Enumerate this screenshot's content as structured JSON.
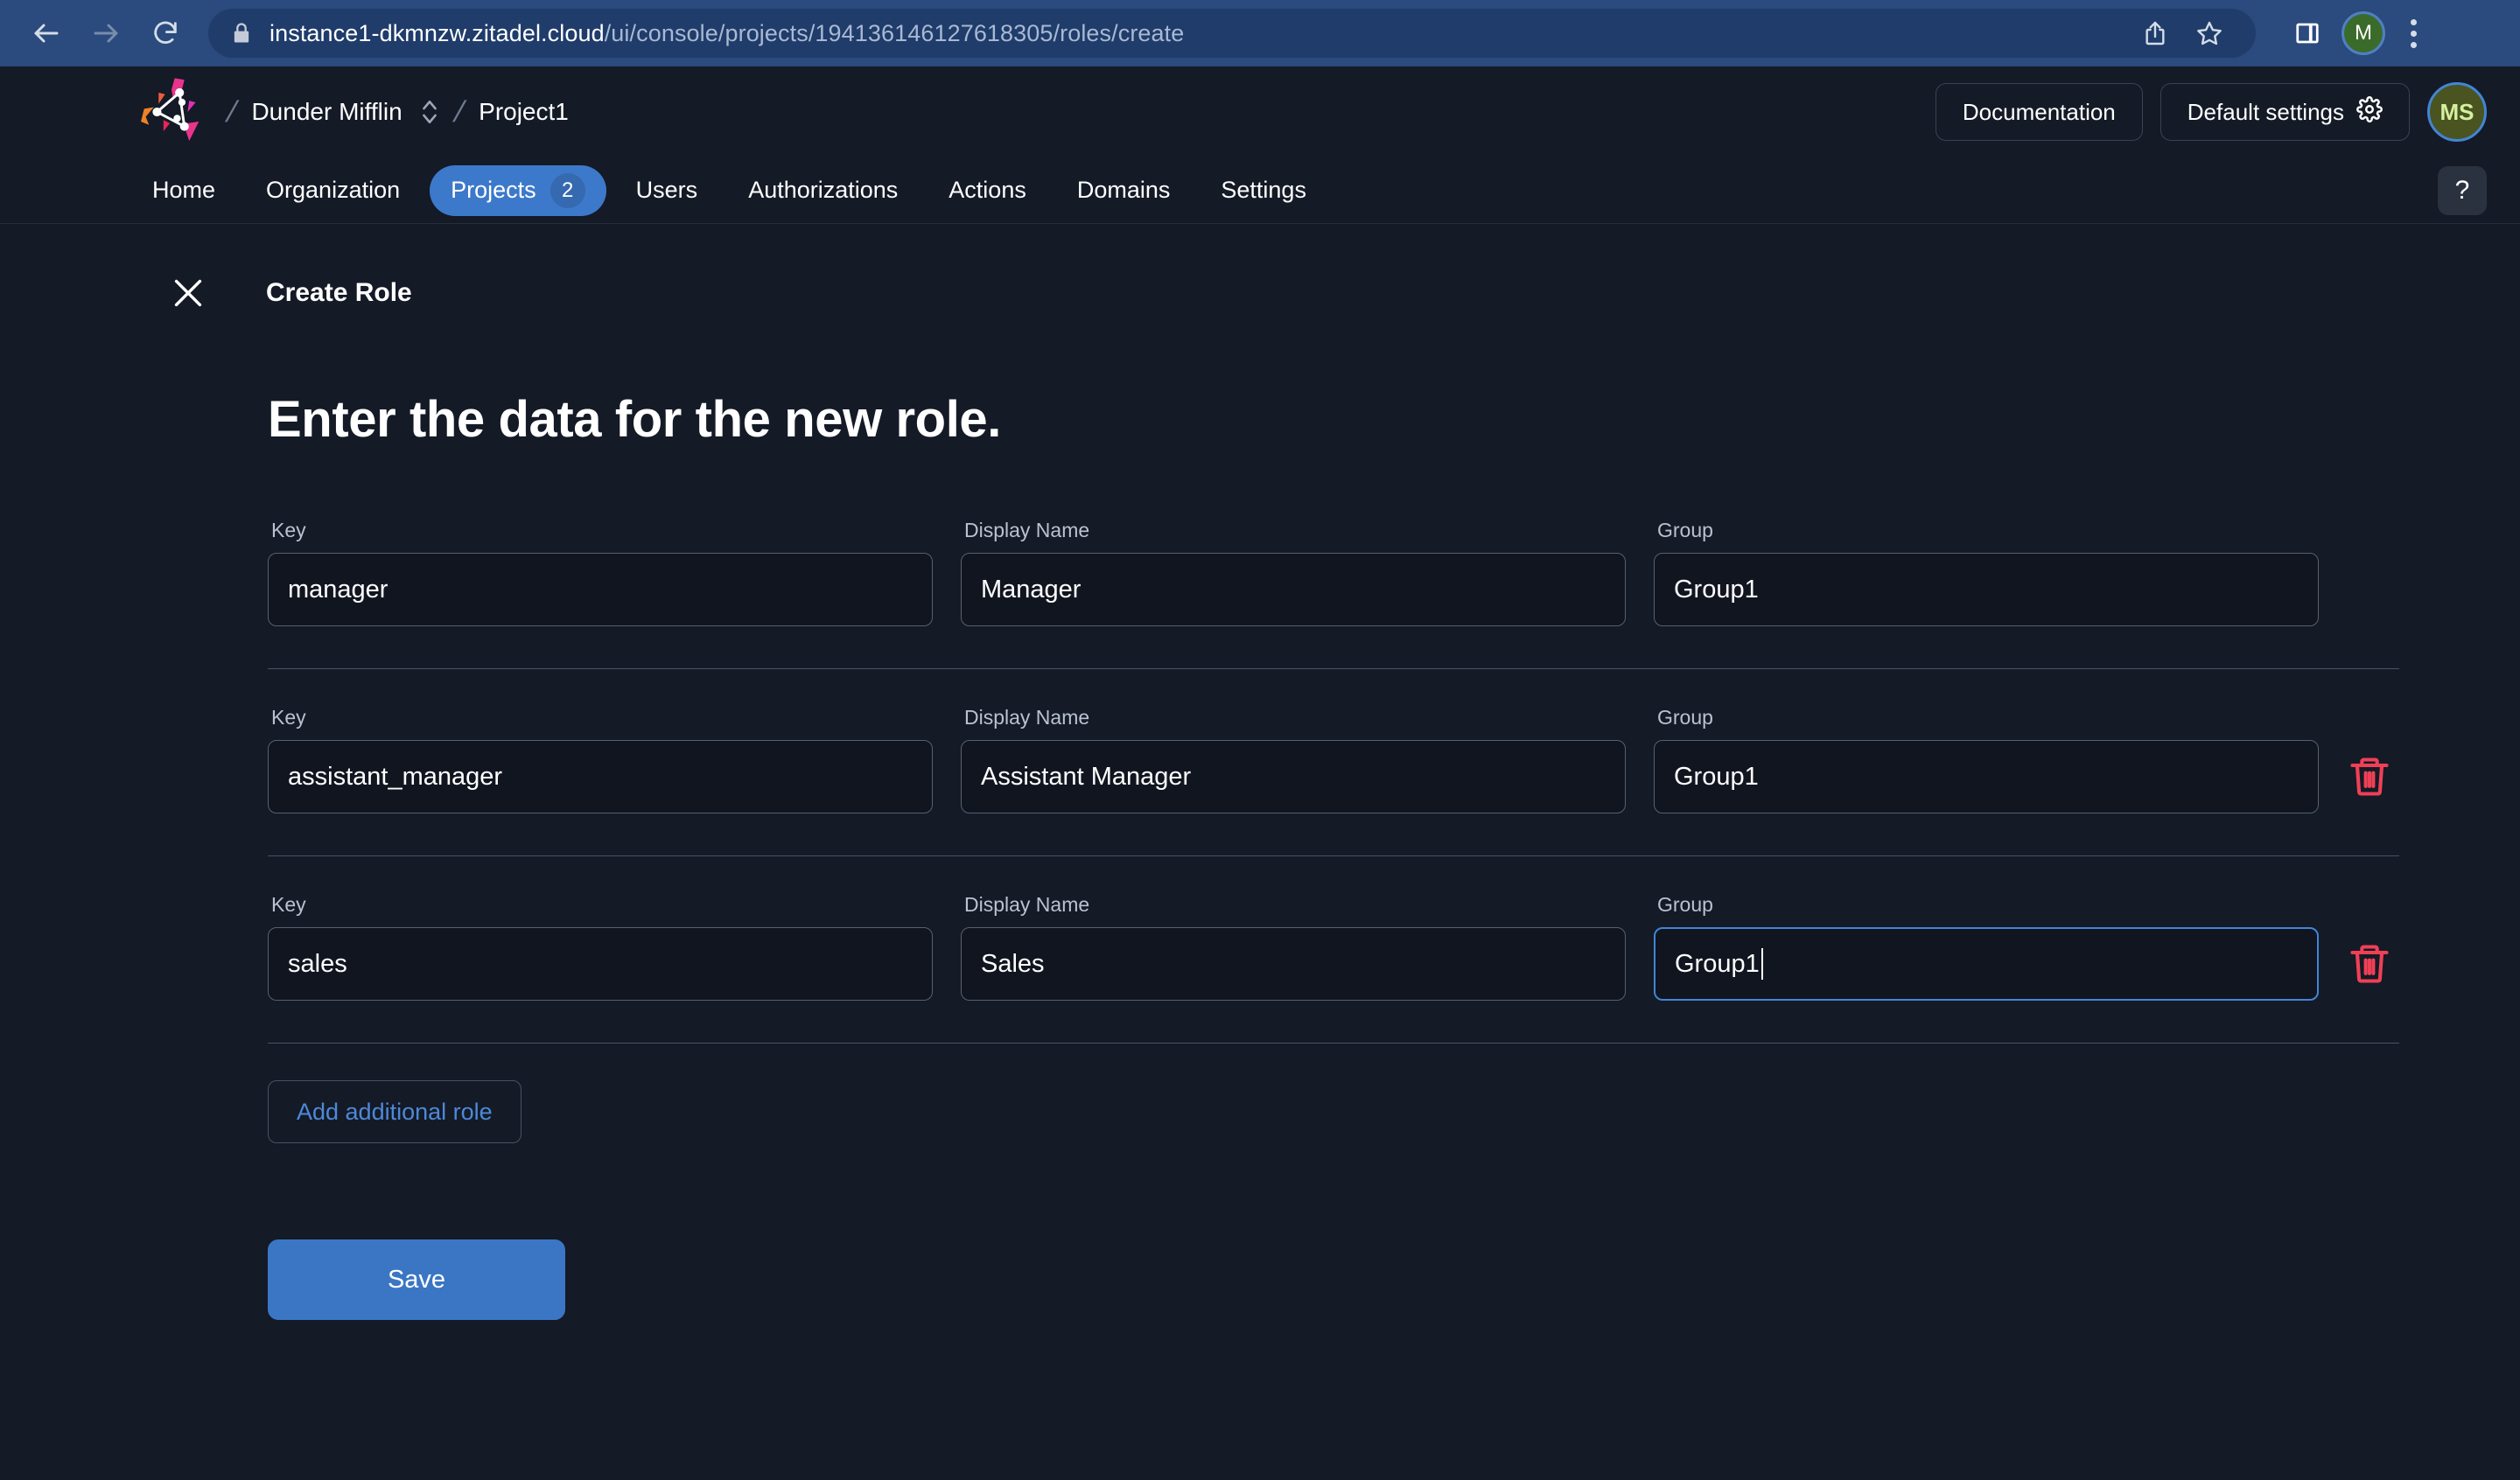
{
  "browser": {
    "back_icon": "back-arrow-icon",
    "forward_icon": "forward-arrow-icon",
    "reload_icon": "reload-icon",
    "lock_icon": "lock-icon",
    "url_domain": "instance1-dkmnzw.zitadel.cloud",
    "url_path": "/ui/console/projects/194136146127618305/roles/create",
    "share_icon": "share-icon",
    "bookmark_icon": "star-icon",
    "sidepanel_icon": "side-panel-icon",
    "profile_initial": "M",
    "menu_icon": "kebab-menu-icon"
  },
  "header": {
    "logo": "zitadel-logo-icon",
    "separator": "/",
    "org_name": "Dunder Mifflin",
    "org_switch_icon": "chevron-up-down-icon",
    "project_name": "Project1",
    "documentation_label": "Documentation",
    "default_settings_label": "Default settings",
    "gear_icon": "gear-icon",
    "user_initials": "MS"
  },
  "nav": {
    "tabs": [
      {
        "label": "Home",
        "active": false,
        "badge": null
      },
      {
        "label": "Organization",
        "active": false,
        "badge": null
      },
      {
        "label": "Projects",
        "active": true,
        "badge": "2"
      },
      {
        "label": "Users",
        "active": false,
        "badge": null
      },
      {
        "label": "Authorizations",
        "active": false,
        "badge": null
      },
      {
        "label": "Actions",
        "active": false,
        "badge": null
      },
      {
        "label": "Domains",
        "active": false,
        "badge": null
      },
      {
        "label": "Settings",
        "active": false,
        "badge": null
      }
    ],
    "help_label": "?"
  },
  "page": {
    "close_icon": "close-icon",
    "subtitle": "Create Role",
    "title": "Enter the data for the new role.",
    "labels": {
      "key": "Key",
      "display_name": "Display Name",
      "group": "Group"
    },
    "roles": [
      {
        "key": "manager",
        "display_name": "Manager",
        "group": "Group1",
        "deletable": false,
        "focused_field": null
      },
      {
        "key": "assistant_manager",
        "display_name": "Assistant Manager",
        "group": "Group1",
        "deletable": true,
        "focused_field": null
      },
      {
        "key": "sales",
        "display_name": "Sales",
        "group": "Group1",
        "deletable": true,
        "focused_field": "group"
      }
    ],
    "add_role_label": "Add additional role",
    "save_label": "Save",
    "delete_icon": "trash-icon"
  },
  "colors": {
    "page_bg": "#141a26",
    "browser_bg": "#2b4a7d",
    "omnibox_bg": "#1f3c6b",
    "accent_blue": "#3a76c4",
    "active_tab_blue": "#3d79ca",
    "link_blue": "#4d89d8",
    "focus_border": "#4285d6",
    "danger_red": "#ef4056",
    "field_border": "#59616e",
    "field_bg": "#101520",
    "label_gray": "#b9c2d0",
    "divider": "#4a5263"
  }
}
